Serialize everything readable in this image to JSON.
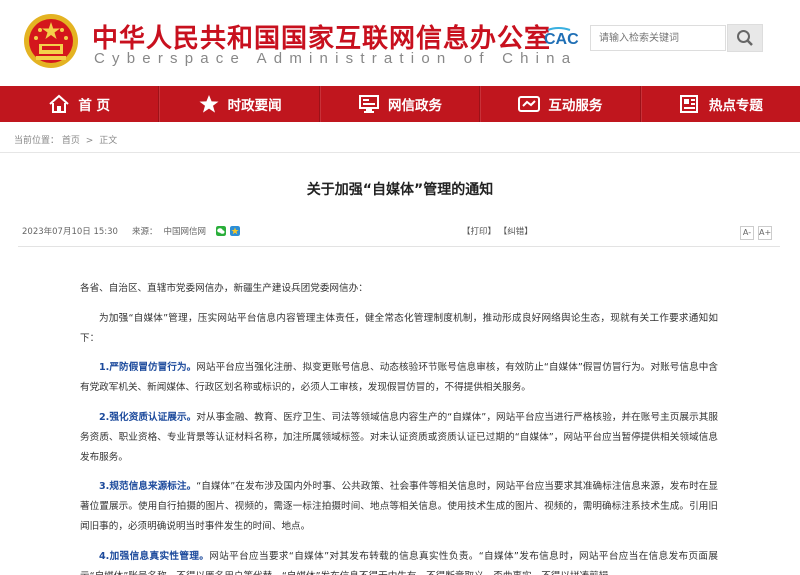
{
  "header": {
    "title": "中华人民共和国国家互联网信息办公室",
    "subtitle": "Cyberspace Administration of China",
    "logo_text": "CAC",
    "search_placeholder": "请输入检索关键词"
  },
  "nav": [
    {
      "label": "首 页",
      "icon": "home-icon"
    },
    {
      "label": "时政要闻",
      "icon": "star-icon"
    },
    {
      "label": "网信政务",
      "icon": "monitor-icon"
    },
    {
      "label": "互动服务",
      "icon": "handshake-icon"
    },
    {
      "label": "热点专题",
      "icon": "newspaper-icon"
    }
  ],
  "breadcrumb": {
    "prefix": "当前位置：",
    "items": [
      "首页",
      "正文"
    ],
    "separator": ">"
  },
  "article": {
    "title": "关于加强“自媒体”管理的通知",
    "date": "2023年07月10日 15:30",
    "source_label": "来源：",
    "source": "中国网信网",
    "print_label": "【打印】",
    "error_label": "【纠错】",
    "font_small": "A-",
    "font_large": "A+",
    "paragraphs": [
      {
        "lead": "",
        "text": "各省、自治区、直辖市党委网信办，新疆生产建设兵团党委网信办："
      },
      {
        "lead": "",
        "text": "为加强“自媒体”管理，压实网站平台信息内容管理主体责任，健全常态化管理制度机制，推动形成良好网络舆论生态，现就有关工作要求通知如下："
      },
      {
        "lead": "1.严防假冒仿冒行为。",
        "text": "网站平台应当强化注册、拟变更账号信息、动态核验环节账号信息审核，有效防止“自媒体”假冒仿冒行为。对账号信息中含有党政军机关、新闻媒体、行政区划名称或标识的，必须人工审核，发现假冒仿冒的，不得提供相关服务。"
      },
      {
        "lead": "2.强化资质认证展示。",
        "text": "对从事金融、教育、医疗卫生、司法等领域信息内容生产的“自媒体”，网站平台应当进行严格核验，并在账号主页展示其服务资质、职业资格、专业背景等认证材料名称，加注所属领域标签。对未认证资质或资质认证已过期的“自媒体”，网站平台应当暂停提供相关领域信息发布服务。"
      },
      {
        "lead": "3.规范信息来源标注。",
        "text": "“自媒体”在发布涉及国内外时事、公共政策、社会事件等相关信息时，网站平台应当要求其准确标注信息来源，发布时在显著位置展示。使用自行拍摄的图片、视频的，需逐一标注拍摄时间、地点等相关信息。使用技术生成的图片、视频的，需明确标注系技术生成。引用旧闻旧事的，必须明确说明当时事件发生的时间、地点。"
      },
      {
        "lead": "4.加强信息真实性管理。",
        "text": "网站平台应当要求“自媒体”对其发布转载的信息真实性负责。“自媒体”发布信息时，网站平台应当在信息发布页面展示“自媒体”账号名称，不得以匿名用户等代替。“自媒体”发布信息不得无中生有，不得断章取义、歪曲事实，不得以拼凑剪辑、"
      }
    ]
  },
  "colors": {
    "brand_red": "#c0161e",
    "title_red": "#c8101e",
    "highlight_blue": "#1c4a9c"
  }
}
